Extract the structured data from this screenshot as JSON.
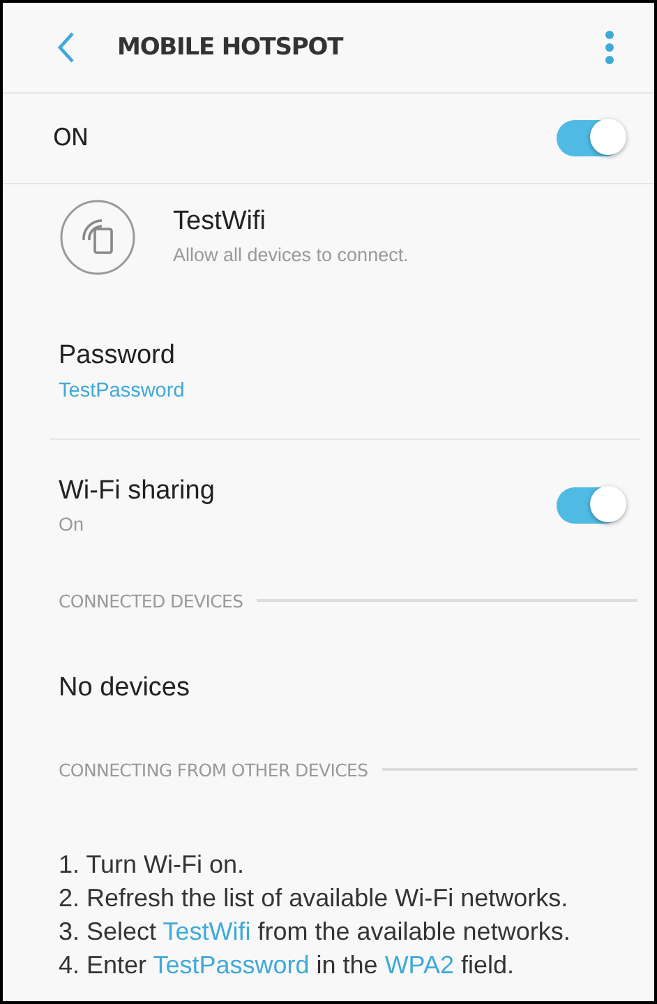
{
  "header": {
    "title": "MOBILE HOTSPOT"
  },
  "master": {
    "label": "ON",
    "on": true
  },
  "network": {
    "name": "TestWifi",
    "subtitle": "Allow all devices to connect."
  },
  "password": {
    "label": "Password",
    "value": "TestPassword"
  },
  "sharing": {
    "label": "Wi-Fi sharing",
    "status": "On",
    "on": true
  },
  "connected_devices": {
    "heading": "CONNECTED DEVICES",
    "empty_text": "No devices"
  },
  "instructions": {
    "heading": "CONNECTING FROM OTHER DEVICES",
    "steps": [
      [
        {
          "text": "1. Turn Wi-Fi on.",
          "highlight": false
        }
      ],
      [
        {
          "text": "2. Refresh the list of available Wi-Fi networks.",
          "highlight": false
        }
      ],
      [
        {
          "text": "3. Select ",
          "highlight": false
        },
        {
          "text": "TestWifi",
          "highlight": true
        },
        {
          "text": " from the available networks.",
          "highlight": false
        }
      ],
      [
        {
          "text": "4. Enter ",
          "highlight": false
        },
        {
          "text": "TestPassword",
          "highlight": true
        },
        {
          "text": " in the ",
          "highlight": false
        },
        {
          "text": "WPA2",
          "highlight": true
        },
        {
          "text": " field.",
          "highlight": false
        }
      ]
    ]
  }
}
